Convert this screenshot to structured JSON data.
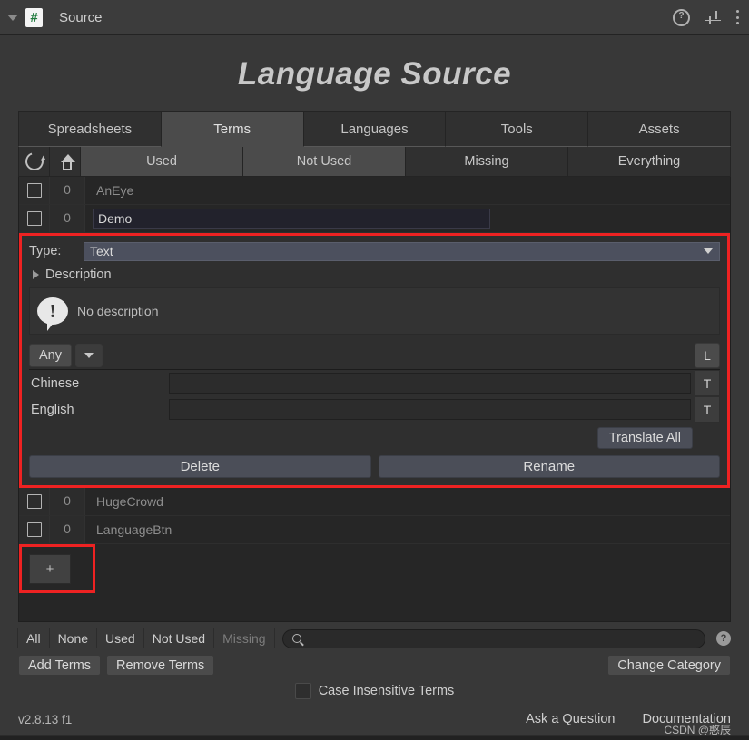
{
  "header": {
    "title": "Source",
    "foldout_icon": "triangle-down-icon",
    "script_icon": "csharp-script-icon",
    "help_icon": "help-icon",
    "preset_icon": "preset-sliders-icon",
    "menu_icon": "kebab-menu-icon"
  },
  "page_title": "Language Source",
  "tabs": [
    {
      "label": "Spreadsheets",
      "active": false
    },
    {
      "label": "Terms",
      "active": true
    },
    {
      "label": "Languages",
      "active": false
    },
    {
      "label": "Tools",
      "active": false
    },
    {
      "label": "Assets",
      "active": false
    }
  ],
  "filter_toolbar": {
    "refresh_icon": "refresh-icon",
    "upload_icon": "upload-icon",
    "segments": [
      {
        "label": "Used",
        "selected": true
      },
      {
        "label": "Not Used",
        "selected": true
      },
      {
        "label": "Missing",
        "selected": false
      },
      {
        "label": "Everything",
        "selected": false
      }
    ]
  },
  "terms": {
    "top_rows": [
      {
        "count": "0",
        "name": "AnEye",
        "editing": false
      },
      {
        "count": "0",
        "name": "Demo",
        "editing": true
      }
    ],
    "bottom_rows": [
      {
        "count": "0",
        "name": "HugeCrowd"
      },
      {
        "count": "0",
        "name": "LanguageBtn"
      }
    ],
    "add_button_label": "+"
  },
  "detail": {
    "type_label": "Type:",
    "type_value": "Text",
    "description_label": "Description",
    "no_description_text": "No description",
    "info_icon": "speech-bubble-exclamation-icon",
    "category_pill": "Any",
    "category_dropdown_icon": "chevron-down-icon",
    "languages_button": "L",
    "language_rows": [
      {
        "name": "Chinese",
        "value": "",
        "action": "T"
      },
      {
        "name": "English",
        "value": "",
        "action": "T"
      }
    ],
    "translate_all_label": "Translate All",
    "delete_label": "Delete",
    "rename_label": "Rename"
  },
  "bottom_toolbar": {
    "segments": [
      {
        "label": "All",
        "dim": false
      },
      {
        "label": "None",
        "dim": false
      },
      {
        "label": "Used",
        "dim": false
      },
      {
        "label": "Not Used",
        "dim": false
      },
      {
        "label": "Missing",
        "dim": true
      }
    ],
    "search_icon": "search-icon",
    "search_value": "",
    "search_placeholder": "",
    "help_icon": "help-circle-icon",
    "add_terms_label": "Add Terms",
    "remove_terms_label": "Remove Terms",
    "change_category_label": "Change Category",
    "case_insensitive_label": "Case Insensitive Terms",
    "case_insensitive_checked": false
  },
  "footer": {
    "version": "v2.8.13 f1",
    "ask_question": "Ask a Question",
    "documentation": "Documentation",
    "watermark": "CSDN @憨辰"
  },
  "colors": {
    "accent_highlight": "#ee2222",
    "panel_bg": "#383838",
    "selected_tab": "#4b4b4b"
  }
}
